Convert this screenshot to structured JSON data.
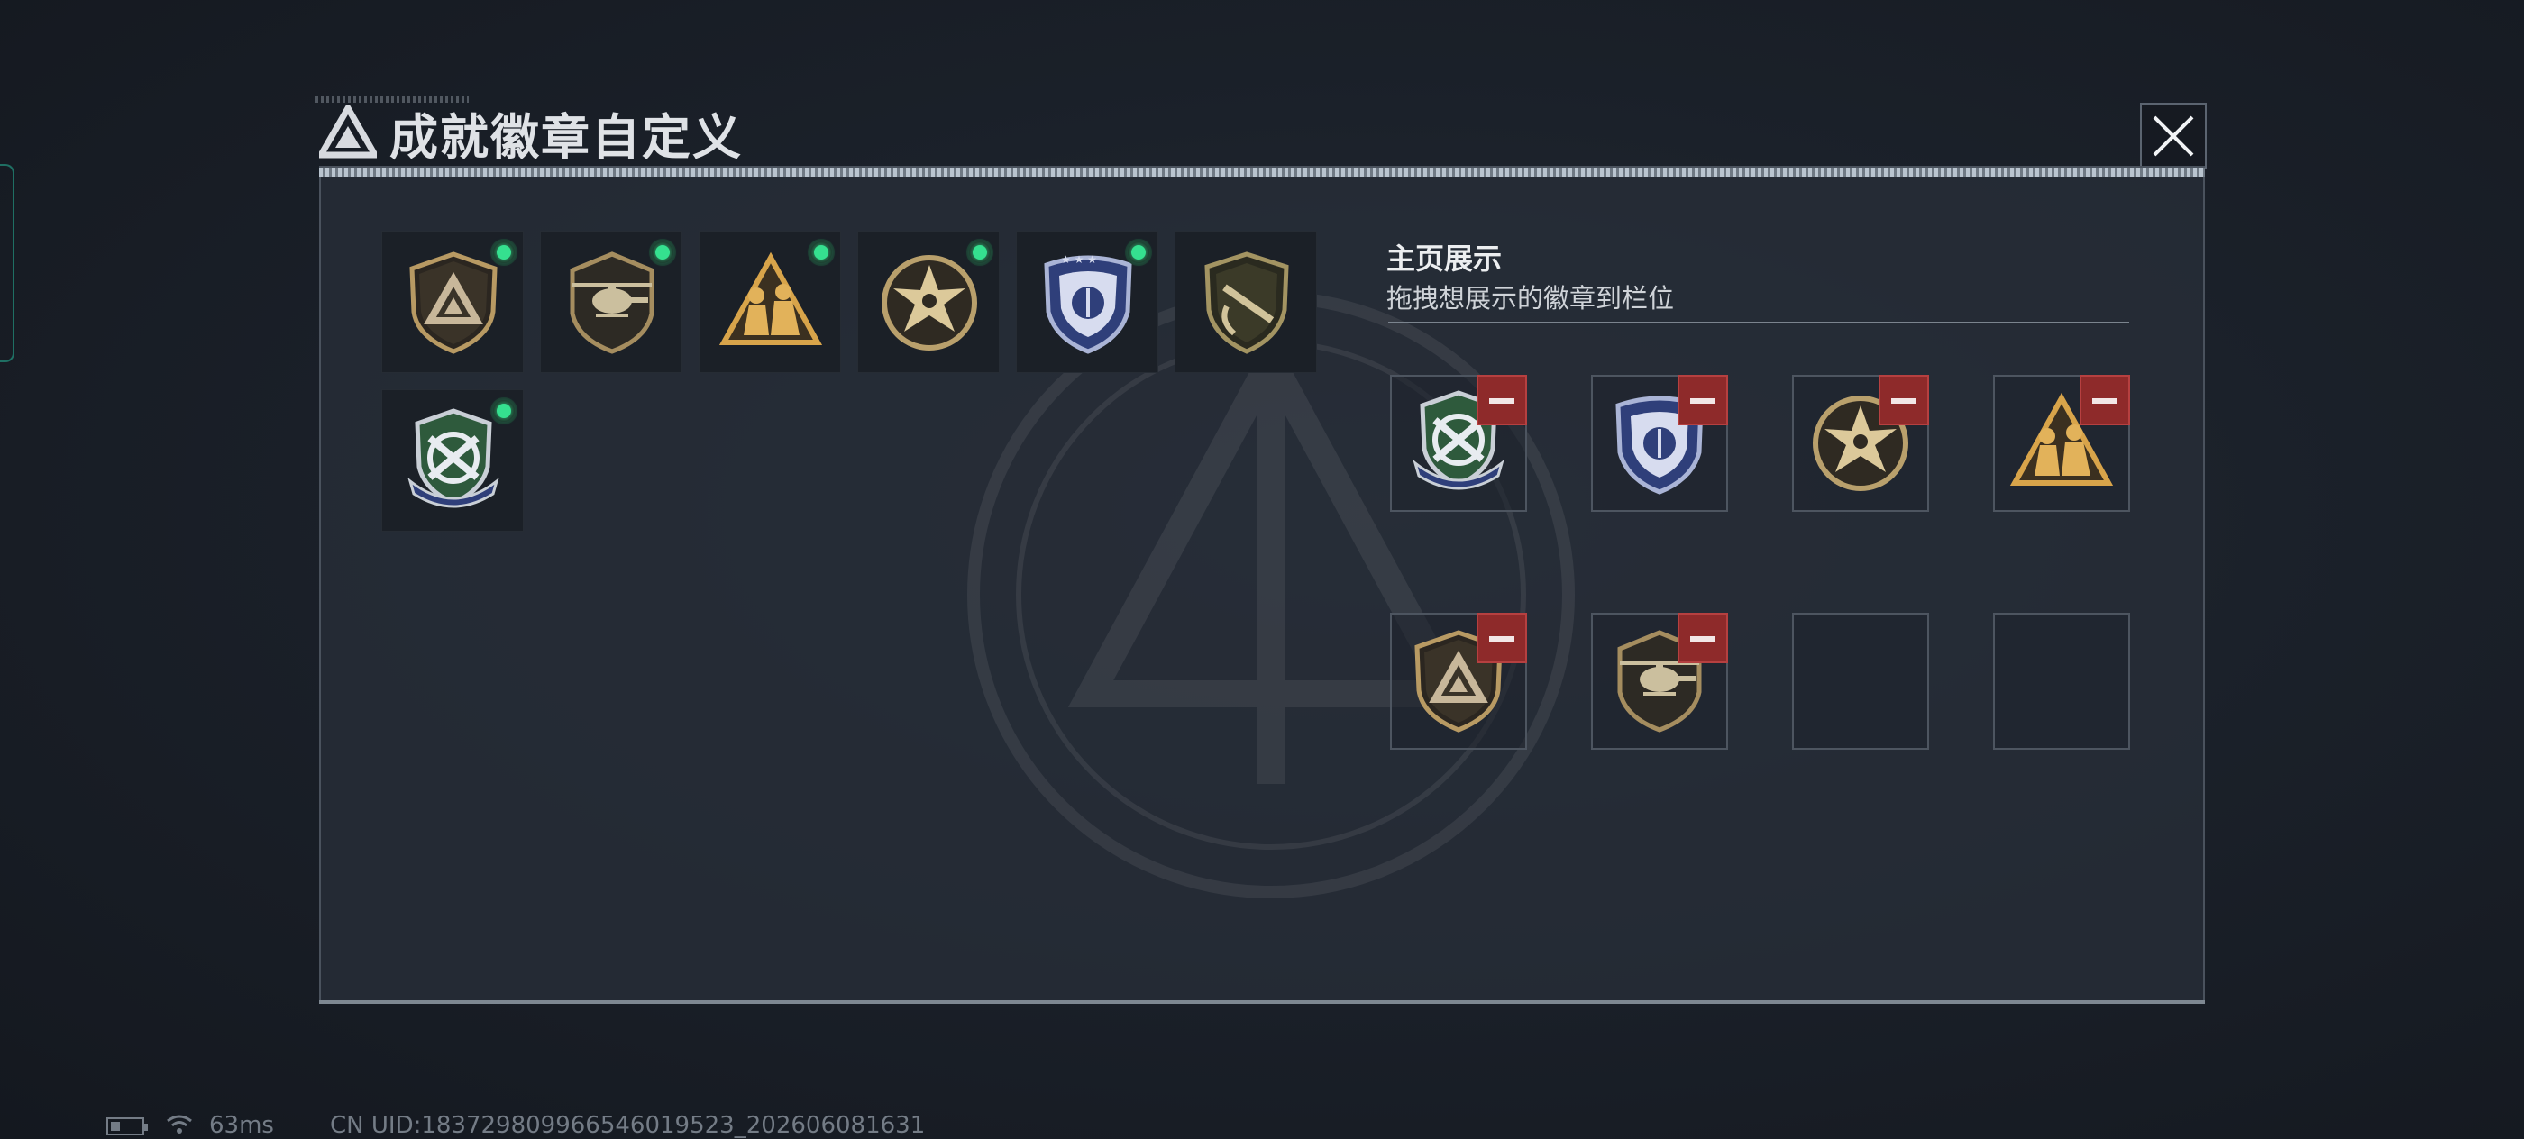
{
  "window": {
    "title": "成就徽章自定义"
  },
  "close_button": {
    "icon": "close-icon"
  },
  "owned_badges": [
    {
      "name": "shield-triangle-badge",
      "equipped": true
    },
    {
      "name": "helicopter-badge",
      "equipped": true
    },
    {
      "name": "soldiers-triangle-badge",
      "equipped": true
    },
    {
      "name": "star-medal-badge",
      "equipped": true
    },
    {
      "name": "police-badge",
      "equipped": true
    },
    {
      "name": "rifle-shield-badge",
      "equipped": false
    },
    {
      "name": "crossed-weapons-badge",
      "equipped": true
    }
  ],
  "homepage_display": {
    "title": "主页展示",
    "subtitle": "拖拽想展示的徽章到栏位",
    "slots": [
      {
        "badge": "crossed-weapons-badge"
      },
      {
        "badge": "police-badge"
      },
      {
        "badge": "star-medal-badge"
      },
      {
        "badge": "soldiers-triangle-badge"
      },
      {
        "badge": "shield-triangle-badge"
      },
      {
        "badge": "helicopter-badge"
      },
      {
        "badge": null
      },
      {
        "badge": null
      }
    ]
  },
  "status_bar": {
    "latency": "63ms",
    "uid": "CN UID:18372980996654601952​3_202606081631"
  },
  "colors": {
    "equipped_dot": "#35e08f",
    "remove_button": "#8e2a2a",
    "gold": "#c9a86a",
    "navy": "#2f3f7a"
  }
}
